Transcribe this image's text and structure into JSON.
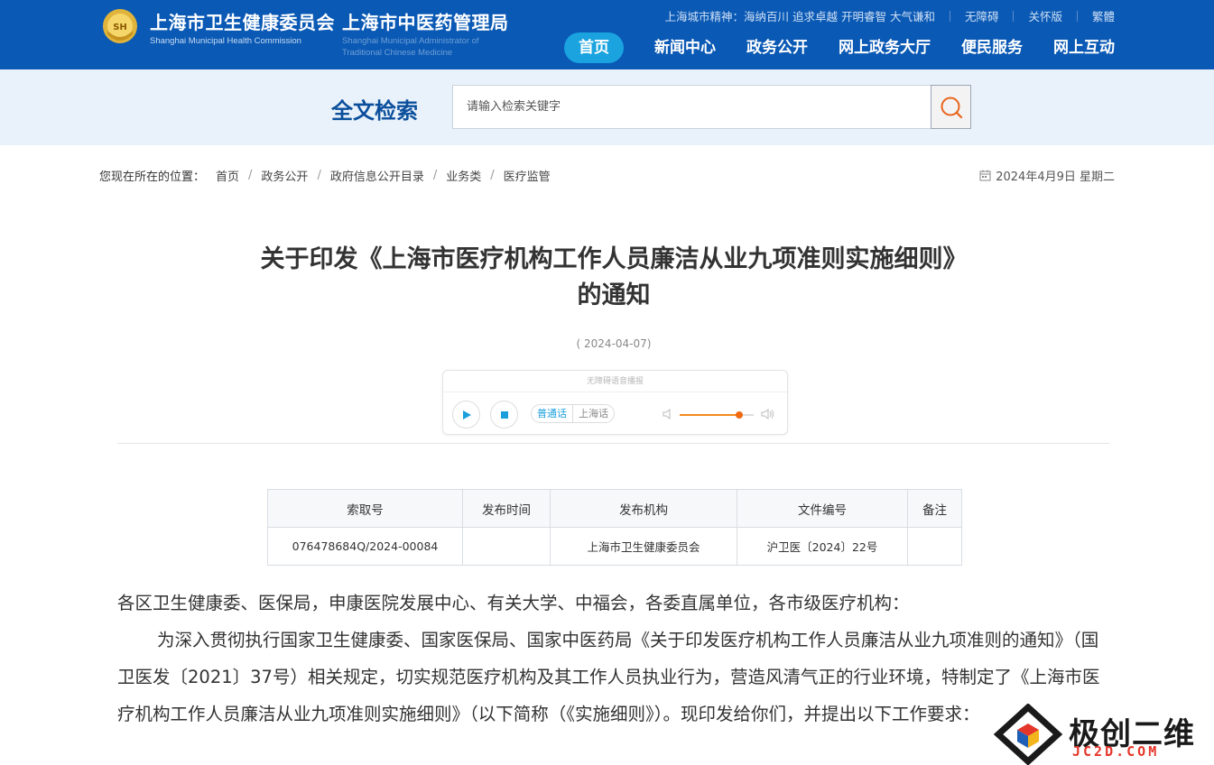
{
  "header": {
    "brand1_cn": "上海市卫生健康委员会",
    "brand1_en": "Shanghai Municipal Health Commission",
    "brand2_cn": "上海市中医药管理局",
    "brand2_en1": "Shanghai Municipal Administrator of",
    "brand2_en2": "Traditional Chinese Medicine",
    "spirit": "上海城市精神：海纳百川 追求卓越 开明睿智 大气谦和",
    "links": [
      "无障碍",
      "关怀版",
      "繁體"
    ],
    "nav": [
      "首页",
      "新闻中心",
      "政务公开",
      "网上政务大厅",
      "便民服务",
      "网上互动"
    ],
    "accent": "#0a59b5",
    "active_nav": "#1aa3df"
  },
  "search": {
    "title": "全文检索",
    "placeholder": "请输入检索关键字",
    "icon": "search-icon",
    "icon_color": "#e8641c"
  },
  "breadcrumb": {
    "lead": "您现在所在的位置：",
    "items": [
      "首页",
      "政务公开",
      "政府信息公开目录",
      "业务类",
      "医疗监管"
    ],
    "date": "2024年4月9日 星期二"
  },
  "article": {
    "title_line1": "关于印发《上海市医疗机构工作人员廉洁从业九项准则实施细则》",
    "title_line2": "的通知",
    "pub_date": "( 2024-04-07)"
  },
  "player": {
    "header": "无障碍语音播报",
    "lang_mandarin": "普通话",
    "lang_shanghai": "上海话",
    "volume": 0.8
  },
  "table": {
    "headers": [
      "索取号",
      "发布时间",
      "发布机构",
      "文件编号",
      "备注"
    ],
    "row": [
      "07647868 4Q/2024-00084",
      "",
      "上海市卫生健康委员会",
      "沪卫医〔2024〕22号",
      ""
    ]
  },
  "body": {
    "salutation": "各区卫生健康委、医保局，申康医院发展中心、有关大学、中福会，各委直属单位，各市级医疗机构：",
    "paragraph": "为深入贯彻执行国家卫生健康委、国家医保局、国家中医药局《关于印发医疗机构工作人员廉洁从业九项准则的通知》（国卫医发〔2021〕37号）相关规定，切实规范医疗机构及其工作人员执业行为，营造风清气正的行业环境，特制定了《上海市医疗机构工作人员廉洁从业九项准则实施细则》（以下简称（《实施细则》）。现印发给你们，并提出以下工作要求："
  },
  "watermark": {
    "text": "极创二维",
    "sub": "JC2D.COM"
  }
}
